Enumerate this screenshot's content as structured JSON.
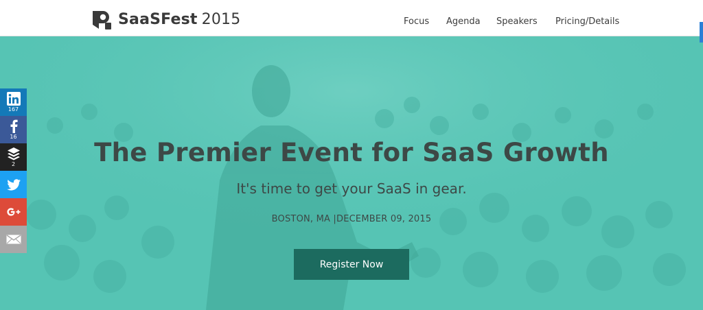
{
  "brand": {
    "name": "SaaSFest",
    "year": "2015",
    "logo_icon": "p-speech-logo-icon"
  },
  "nav": {
    "items": [
      {
        "label": "Focus"
      },
      {
        "label": "Agenda"
      },
      {
        "label": "Speakers"
      },
      {
        "label": "Pricing/Details"
      }
    ]
  },
  "hero": {
    "title": "The Premier Event for SaaS Growth",
    "subtitle": "It's time to get your SaaS in gear.",
    "meta": "BOSTON, MA |DECEMBER 09, 2015",
    "register_label": "Register Now"
  },
  "share": {
    "linkedin": {
      "icon": "linkedin-icon",
      "count": "167"
    },
    "facebook": {
      "icon": "facebook-icon",
      "count": "16"
    },
    "buffer": {
      "icon": "buffer-icon",
      "count": "2"
    },
    "twitter": {
      "icon": "twitter-icon"
    },
    "google": {
      "icon": "google-plus-icon"
    },
    "email": {
      "icon": "email-icon"
    }
  },
  "colors": {
    "hero_overlay": "#53c2b2",
    "button": "#1c6b5f",
    "heading_text": "#3d4846",
    "linkedin": "#1479b8",
    "facebook": "#3b5998",
    "buffer": "#222222",
    "twitter": "#1da1f2",
    "google": "#dd4b39",
    "email": "#a8a8a8"
  }
}
